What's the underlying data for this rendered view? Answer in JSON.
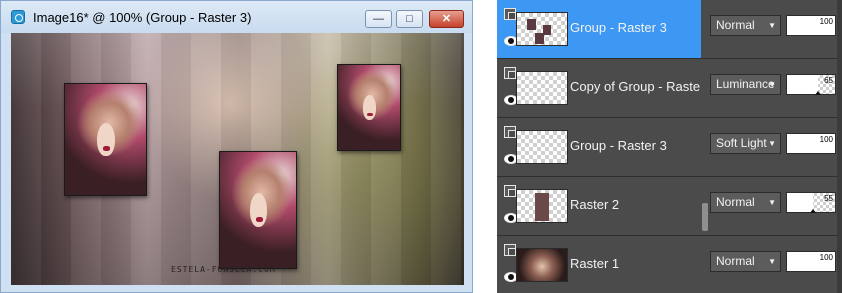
{
  "window": {
    "title": "Image16* @ 100% (Group - Raster 3)",
    "buttons": {
      "minimize": "—",
      "maximize": "□",
      "close": "✕"
    },
    "watermark": "ESTELA-FONSECA.COM"
  },
  "layers": [
    {
      "name": "Group - Raster 3",
      "blend_mode": "Normal",
      "opacity": 100,
      "selected": true,
      "thumb": "faces"
    },
    {
      "name": "Copy of Group - Raste",
      "blend_mode": "Luminance",
      "opacity": 65,
      "selected": false,
      "thumb": "empty"
    },
    {
      "name": "Group - Raster 3",
      "blend_mode": "Soft Light",
      "opacity": 100,
      "selected": false,
      "thumb": "empty"
    },
    {
      "name": "Raster 2",
      "blend_mode": "Normal",
      "opacity": 55,
      "selected": false,
      "thumb": "portrait"
    },
    {
      "name": "Raster 1",
      "blend_mode": "Normal",
      "opacity": 100,
      "selected": false,
      "thumb": "photo"
    }
  ],
  "icons": {
    "app": "paintshop-app-icon",
    "link": "link-icon",
    "visibility": "eye-icon",
    "dropdown": "chevron-down-icon"
  },
  "colors": {
    "selected_row": "#3c98f3",
    "palette_bg": "#4b4b4b",
    "titlebar": "#cfe0f3"
  }
}
